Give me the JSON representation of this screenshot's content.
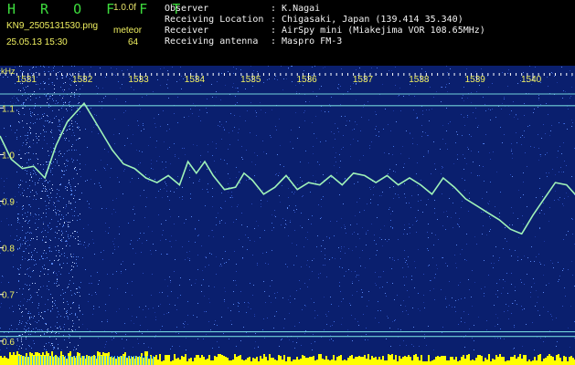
{
  "header": {
    "app_title": "H R O F F T",
    "version": "1.0.0f",
    "filename": "KN9_2505131530.png",
    "datetime": "25.05.13 15:30",
    "meteor_label": "meteor",
    "meteor_count": "64",
    "info": [
      {
        "key": "Observer",
        "value": ": K.Nagai"
      },
      {
        "key": "Receiving Location",
        "value": ": Chigasaki, Japan (139.414 35.340)"
      },
      {
        "key": "Receiver",
        "value": ": AirSpy mini (Miakejima VOR 108.65MHz)"
      },
      {
        "key": "Receiving antenna",
        "value": ": Maspro FM-3"
      }
    ]
  },
  "chart_data": {
    "type": "line",
    "ylabel": "kHz",
    "x_ticks": [
      "1531",
      "1532",
      "1533",
      "1534",
      "1535",
      "1536",
      "1537",
      "1538",
      "1539",
      "1540"
    ],
    "xlim": [
      1530.5,
      1540.75
    ],
    "ylim": [
      0.58,
      1.175
    ],
    "y_ticks": [
      "1.1",
      "1.0",
      "0.9",
      "0.8",
      "0.7",
      "0.6"
    ],
    "y_tick_values": [
      1.1,
      1.0,
      0.9,
      0.8,
      0.7,
      0.6
    ],
    "colors": {
      "background": "#0a1f6e",
      "trace": "#9ff2b8",
      "carrier": "#7fe6e6",
      "tick_label": "#f0f060",
      "level_bar": "#ffff00"
    },
    "carrier_lines": [
      1.13,
      1.105,
      0.62,
      0.61
    ],
    "series": [
      {
        "x": [
          1530.5,
          1530.7,
          1530.9,
          1531.1,
          1531.3,
          1531.5,
          1531.7,
          1531.85,
          1532.0,
          1532.15,
          1532.3,
          1532.5,
          1532.7,
          1532.9,
          1533.1,
          1533.3,
          1533.5,
          1533.7,
          1533.85,
          1534.0,
          1534.15,
          1534.3,
          1534.5,
          1534.7,
          1534.85,
          1535.0,
          1535.2,
          1535.4,
          1535.6,
          1535.8,
          1536.0,
          1536.2,
          1536.4,
          1536.6,
          1536.8,
          1537.0,
          1537.2,
          1537.4,
          1537.6,
          1537.8,
          1538.0,
          1538.2,
          1538.4,
          1538.6,
          1538.8,
          1539.0,
          1539.2,
          1539.4,
          1539.6,
          1539.8,
          1540.0,
          1540.2,
          1540.4,
          1540.6,
          1540.75
        ],
        "y": [
          1.04,
          0.99,
          0.97,
          0.975,
          0.95,
          1.02,
          1.07,
          1.09,
          1.11,
          1.08,
          1.05,
          1.01,
          0.98,
          0.97,
          0.95,
          0.94,
          0.955,
          0.935,
          0.985,
          0.96,
          0.985,
          0.955,
          0.925,
          0.93,
          0.96,
          0.945,
          0.915,
          0.93,
          0.955,
          0.925,
          0.94,
          0.935,
          0.955,
          0.935,
          0.96,
          0.955,
          0.94,
          0.955,
          0.935,
          0.95,
          0.935,
          0.915,
          0.95,
          0.93,
          0.905,
          0.89,
          0.875,
          0.86,
          0.84,
          0.83,
          0.87,
          0.905,
          0.94,
          0.935,
          0.915
        ]
      }
    ]
  }
}
